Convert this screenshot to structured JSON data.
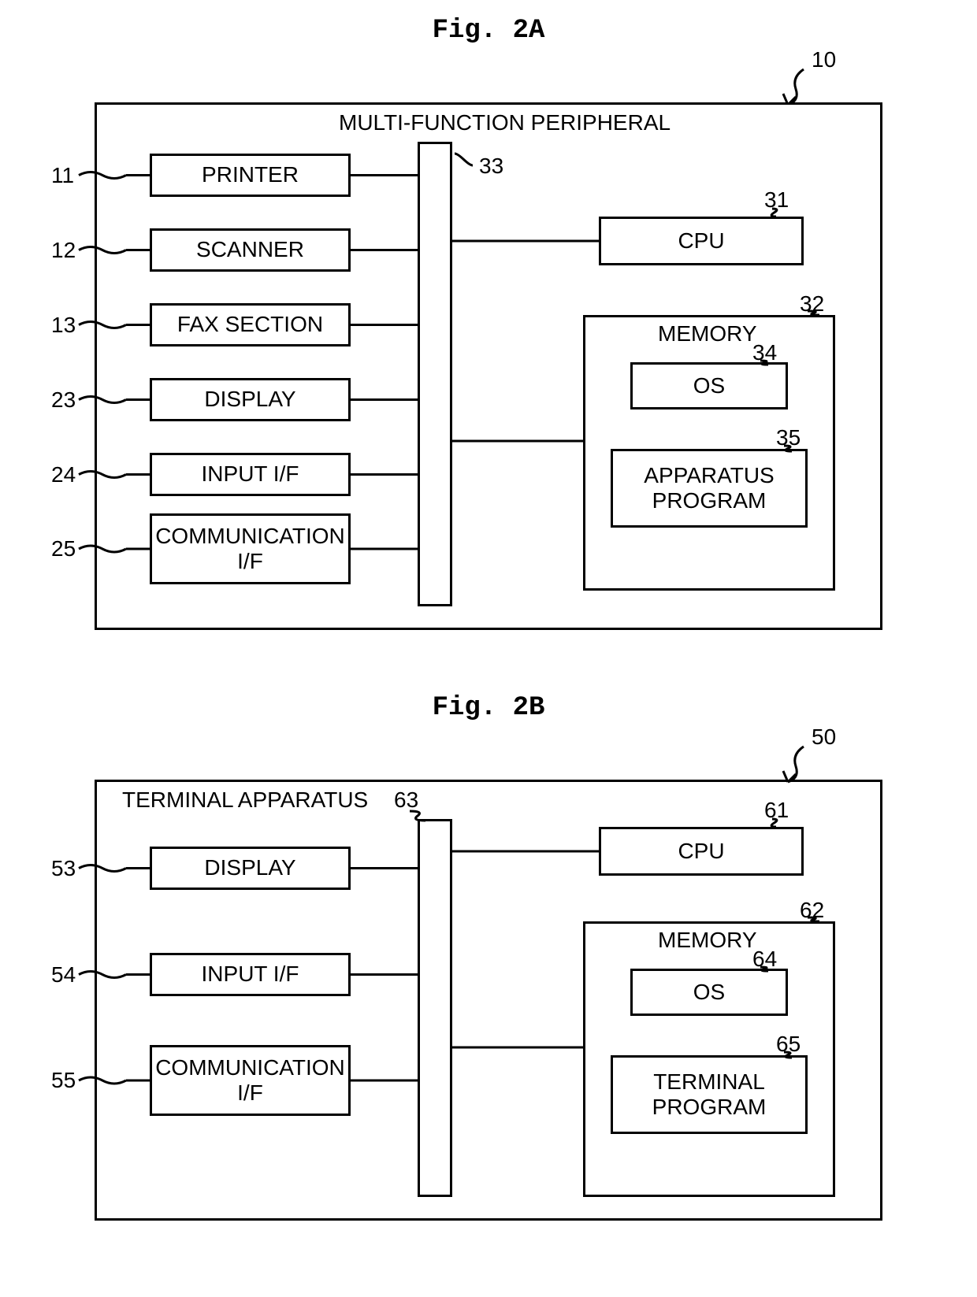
{
  "figA": {
    "title": "Fig. 2A",
    "outer_ref": "10",
    "outer_title": "MULTI-FUNCTION PERIPHERAL",
    "bus_ref": "33",
    "left_blocks": [
      {
        "ref": "11",
        "label": "PRINTER"
      },
      {
        "ref": "12",
        "label": "SCANNER"
      },
      {
        "ref": "13",
        "label": "FAX SECTION"
      },
      {
        "ref": "23",
        "label": "DISPLAY"
      },
      {
        "ref": "24",
        "label": "INPUT I/F"
      },
      {
        "ref": "25",
        "label": "COMMUNICATION\nI/F"
      }
    ],
    "cpu": {
      "ref": "31",
      "label": "CPU"
    },
    "memory": {
      "ref": "32",
      "label": "MEMORY",
      "os": {
        "ref": "34",
        "label": "OS"
      },
      "prog": {
        "ref": "35",
        "label": "APPARATUS\nPROGRAM"
      }
    }
  },
  "figB": {
    "title": "Fig. 2B",
    "outer_ref": "50",
    "outer_title": "TERMINAL APPARATUS",
    "bus_ref": "63",
    "left_blocks": [
      {
        "ref": "53",
        "label": "DISPLAY"
      },
      {
        "ref": "54",
        "label": "INPUT I/F"
      },
      {
        "ref": "55",
        "label": "COMMUNICATION\nI/F"
      }
    ],
    "cpu": {
      "ref": "61",
      "label": "CPU"
    },
    "memory": {
      "ref": "62",
      "label": "MEMORY",
      "os": {
        "ref": "64",
        "label": "OS"
      },
      "prog": {
        "ref": "65",
        "label": "TERMINAL\nPROGRAM"
      }
    }
  }
}
